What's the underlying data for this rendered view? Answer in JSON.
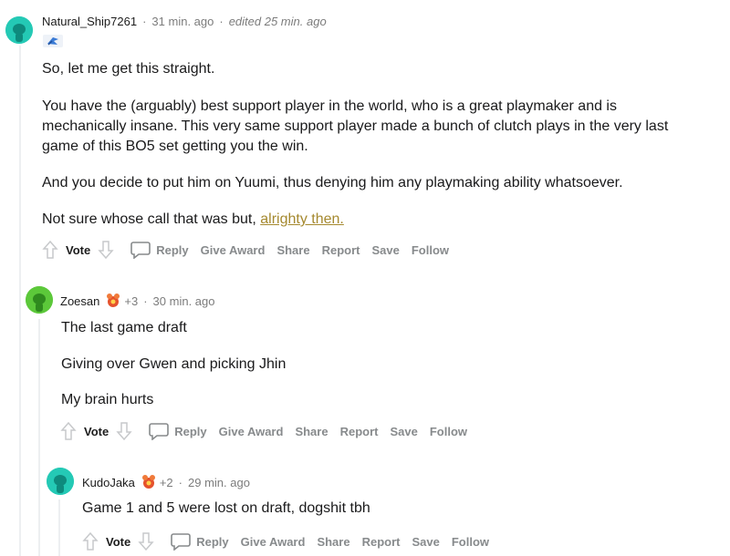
{
  "comments": [
    {
      "author": "Natural_Ship7261",
      "time": "31 min. ago",
      "edited": "edited 25 min. ago",
      "paragraphs": [
        "So, let me get this straight.",
        "You have the (arguably) best support player in the world, who is a great playmaker and is",
        "mechanically insane. This very same support player made a bunch of clutch plays in the very last",
        "game of this BO5 set getting you the win.",
        "And you decide to put him on Yuumi, thus denying him any playmaking ability whatsoever.",
        "Not sure whose call that was but, "
      ],
      "link_text": "alrighty then."
    },
    {
      "author": "Zoesan",
      "flair_count": "+3",
      "time": "30 min. ago",
      "paragraphs": [
        "The last game draft",
        "Giving over Gwen and picking Jhin",
        "My brain hurts"
      ]
    },
    {
      "author": "KudoJaka",
      "flair_count": "+2",
      "time": "29 min. ago",
      "paragraphs": [
        "Game 1 and 5 were lost on draft, dogshit tbh"
      ]
    }
  ],
  "actions": {
    "vote": "Vote",
    "reply": "Reply",
    "give_award": "Give Award",
    "share": "Share",
    "report": "Report",
    "save": "Save",
    "follow": "Follow"
  },
  "colors": {
    "avatar_teal": "#24c9b5",
    "avatar_green": "#5cc83a",
    "link": "#a5892f",
    "meta": "#7c7c7c"
  },
  "icons": [
    "snoo-avatar-icon",
    "flair-icon",
    "upvote-icon",
    "downvote-icon",
    "reply-bubble-icon",
    "award-flair-icon"
  ]
}
